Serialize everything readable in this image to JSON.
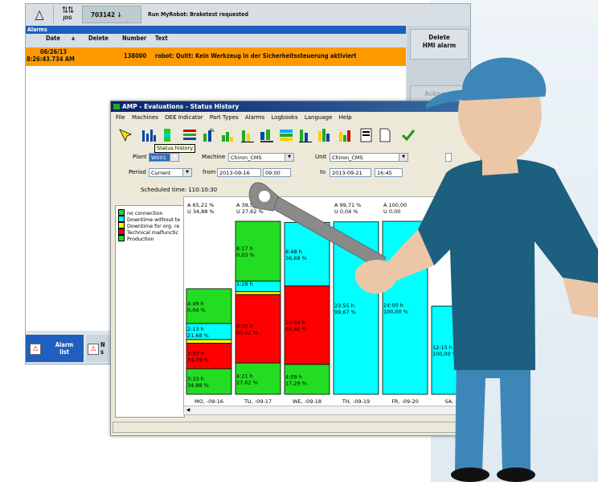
{
  "topbar": {
    "mode": "JOG",
    "program_number": "703142",
    "program_arrow": "↓",
    "status_message": "Run MyRobot: Braketest requested"
  },
  "alarms": {
    "header": "Alarms",
    "columns": [
      "Date",
      "Delete",
      "Number",
      "Text"
    ],
    "rows": [
      {
        "date": "06/26/13",
        "time": "8:26:43.734 AM",
        "delete": "",
        "number": "138000",
        "text": "robot: Quitt: Kein Werkzeug in der Sicherheitssteuerung aktiviert"
      }
    ]
  },
  "softkeys": [
    {
      "label1": "Delete",
      "label2": "HMI alarm",
      "enabled": true
    },
    {
      "label1": "Acknowl.",
      "label2": "alarm",
      "enabled": false
    }
  ],
  "bottom_tabs": {
    "alarm_list_line1": "Alarm",
    "alarm_list_line2": "list",
    "second_line1": "N",
    "second_line2": "s"
  },
  "amp": {
    "title": "AMP - Evaluations - Status History",
    "menu": [
      "File",
      "Machines",
      "OEE Indicator",
      "Part Types",
      "Alarms",
      "Logbooks",
      "Language",
      "Help"
    ],
    "tooltip": "Status history",
    "plant_label": "Plant",
    "plant_value": "W001",
    "machine_label": "Machine",
    "machine_value": "Chiron_CMS",
    "unit_label": "Unit",
    "unit_value": "Chiron_CMS",
    "period_label": "Period",
    "period_value": "Current",
    "from_label": "from",
    "from_date": "2013-09-16",
    "from_time": "09:00",
    "to_label": "to",
    "to_date": "2013-09-21",
    "to_time": "16:45",
    "scheduled_time": "Scheduled time:  110:10:30",
    "legend": [
      {
        "label": "no connection",
        "color": "#33cc33"
      },
      {
        "label": "Downtime without te",
        "color": "#00ffff"
      },
      {
        "label": "Downtime for org. re",
        "color": "#ffff00"
      },
      {
        "label": "Technical malfunctic",
        "color": "#ff0000"
      },
      {
        "label": "Production",
        "color": "#22dd22"
      }
    ]
  },
  "chart_data": {
    "type": "bar",
    "categories": [
      "MO, -09-16",
      "TU, -09-17",
      "WE, -09-18",
      "TH, -09-19",
      "FR, -09-20",
      "SA, -09"
    ],
    "headers": [
      {
        "a": "A 65,21 %",
        "u": "U 34,88 %"
      },
      {
        "a": "A 39,58 %",
        "u": "U 27,62 %"
      },
      {
        "a": "",
        "u": "U"
      },
      {
        "a": "A 99,71 %",
        "u": "U 0,04 %"
      },
      {
        "a": "A 100,00",
        "u": "U 0,00"
      },
      {
        "a": "00,0",
        "u": ""
      }
    ],
    "columns": [
      [
        {
          "state": "Production",
          "h": "4:49 h",
          "pct": "0,04 %",
          "height": 4.82
        },
        {
          "state": "Downtime without te",
          "h": "2:13 h",
          "pct": "21,68 %",
          "height": 2.22
        },
        {
          "state": "Downtime for org. re",
          "h": "",
          "pct": "",
          "height": 0.5
        },
        {
          "state": "Technical malfunctic",
          "h": "3:33 h",
          "pct": "34,79 %",
          "height": 3.55
        },
        {
          "state": "Production",
          "h": "3:33 h",
          "pct": "34,88 %",
          "height": 3.55
        }
      ],
      [
        {
          "state": "Production",
          "h": "8:17 h",
          "pct": "0,03 %",
          "height": 8.28
        },
        {
          "state": "Downtime without te",
          "h": "1:28 h",
          "pct": "",
          "height": 1.47
        },
        {
          "state": "Downtime for org. re",
          "h": "",
          "pct": "",
          "height": 0.4
        },
        {
          "state": "Technical malfunctic",
          "h": "9:30 h",
          "pct": "60,42 %",
          "height": 9.5
        },
        {
          "state": "Production",
          "h": "4:21 h",
          "pct": "27,62 %",
          "height": 4.35
        }
      ],
      [
        {
          "state": "Downtime without te",
          "h": "8:48 h",
          "pct": "36,68 %",
          "height": 8.8
        },
        {
          "state": "Technical malfunctic",
          "h": "10:54 h",
          "pct": "45,41 %",
          "height": 10.9
        },
        {
          "state": "Production",
          "h": "4:09 h",
          "pct": "17,29 %",
          "height": 4.15
        }
      ],
      [
        {
          "state": "Downtime without te",
          "h": "23:55 h",
          "pct": "99,67 %",
          "height": 23.92
        }
      ],
      [
        {
          "state": "Downtime without te",
          "h": "24:00 h",
          "pct": "100,00 %",
          "height": 24
        }
      ],
      [
        {
          "state": "Downtime without te",
          "h": "12:15 h",
          "pct": "100,00 %",
          "height": 12.25
        }
      ]
    ],
    "ylim": [
      0,
      24
    ]
  }
}
